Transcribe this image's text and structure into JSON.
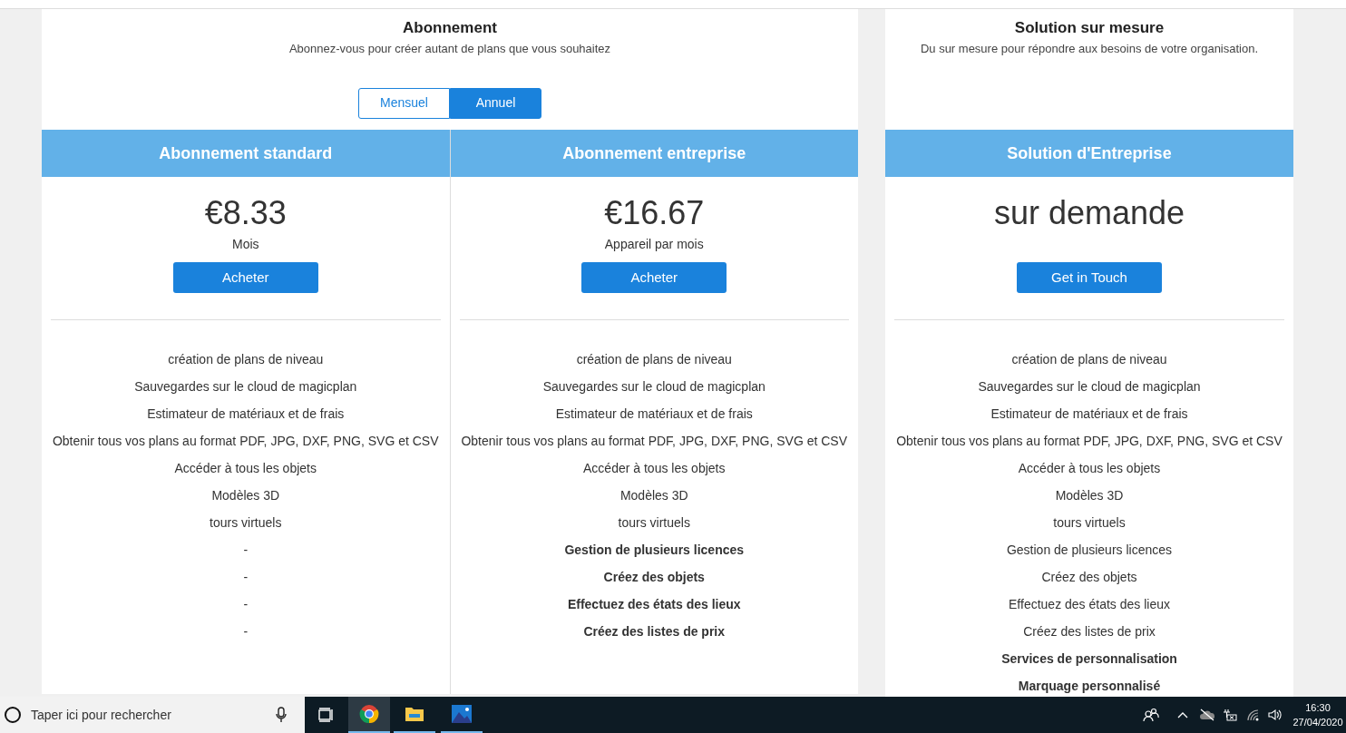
{
  "subscription": {
    "title": "Abonnement",
    "subtitle": "Abonnez-vous pour créer autant de plans que vous souhaitez",
    "billing_toggle": [
      {
        "label": "Mensuel",
        "selected": false
      },
      {
        "label": "Annuel",
        "selected": true
      }
    ],
    "plans": [
      {
        "name": "Abonnement standard",
        "price": "€8.33",
        "period": "Mois",
        "button": "Acheter",
        "features": [
          {
            "text": "création de plans de niveau",
            "bold": false
          },
          {
            "text": "Sauvegardes sur le cloud de magicplan",
            "bold": false
          },
          {
            "text": "Estimateur de matériaux et de frais",
            "bold": false
          },
          {
            "text": "Obtenir tous vos plans au format PDF, JPG, DXF, PNG, SVG et CSV",
            "bold": false
          },
          {
            "text": "Accéder à tous les objets",
            "bold": false
          },
          {
            "text": "Modèles 3D",
            "bold": false
          },
          {
            "text": "tours virtuels",
            "bold": false
          },
          {
            "text": "-",
            "bold": false
          },
          {
            "text": "-",
            "bold": false
          },
          {
            "text": "-",
            "bold": false
          },
          {
            "text": "-",
            "bold": false
          }
        ]
      },
      {
        "name": "Abonnement entreprise",
        "price": "€16.67",
        "period": "Appareil par mois",
        "button": "Acheter",
        "features": [
          {
            "text": "création de plans de niveau",
            "bold": false
          },
          {
            "text": "Sauvegardes sur le cloud de magicplan",
            "bold": false
          },
          {
            "text": "Estimateur de matériaux et de frais",
            "bold": false
          },
          {
            "text": "Obtenir tous vos plans au format PDF, JPG, DXF, PNG, SVG et CSV",
            "bold": false
          },
          {
            "text": "Accéder à tous les objets",
            "bold": false
          },
          {
            "text": "Modèles 3D",
            "bold": false
          },
          {
            "text": "tours virtuels",
            "bold": false
          },
          {
            "text": "Gestion de plusieurs licences",
            "bold": true
          },
          {
            "text": "Créez des objets",
            "bold": true
          },
          {
            "text": "Effectuez des états des lieux",
            "bold": true
          },
          {
            "text": "Créez des listes de prix",
            "bold": true
          }
        ]
      }
    ]
  },
  "custom": {
    "title": "Solution sur mesure",
    "subtitle": "Du sur mesure pour répondre aux besoins de votre organisation.",
    "plan": {
      "name": "Solution d'Entreprise",
      "price": "sur demande",
      "button": "Get in Touch",
      "features": [
        {
          "text": "création de plans de niveau",
          "bold": false
        },
        {
          "text": "Sauvegardes sur le cloud de magicplan",
          "bold": false
        },
        {
          "text": "Estimateur de matériaux et de frais",
          "bold": false
        },
        {
          "text": "Obtenir tous vos plans au format PDF, JPG, DXF, PNG, SVG et CSV",
          "bold": false
        },
        {
          "text": "Accéder à tous les objets",
          "bold": false
        },
        {
          "text": "Modèles 3D",
          "bold": false
        },
        {
          "text": "tours virtuels",
          "bold": false
        },
        {
          "text": "Gestion de plusieurs licences",
          "bold": false
        },
        {
          "text": "Créez des objets",
          "bold": false
        },
        {
          "text": "Effectuez des états des lieux",
          "bold": false
        },
        {
          "text": "Créez des listes de prix",
          "bold": false
        },
        {
          "text": "Services de personnalisation",
          "bold": true
        },
        {
          "text": "Marquage personnalisé",
          "bold": true
        }
      ]
    }
  },
  "taskbar": {
    "search_placeholder": "Taper ici pour rechercher",
    "time": "16:30",
    "date": "27/04/2020"
  }
}
